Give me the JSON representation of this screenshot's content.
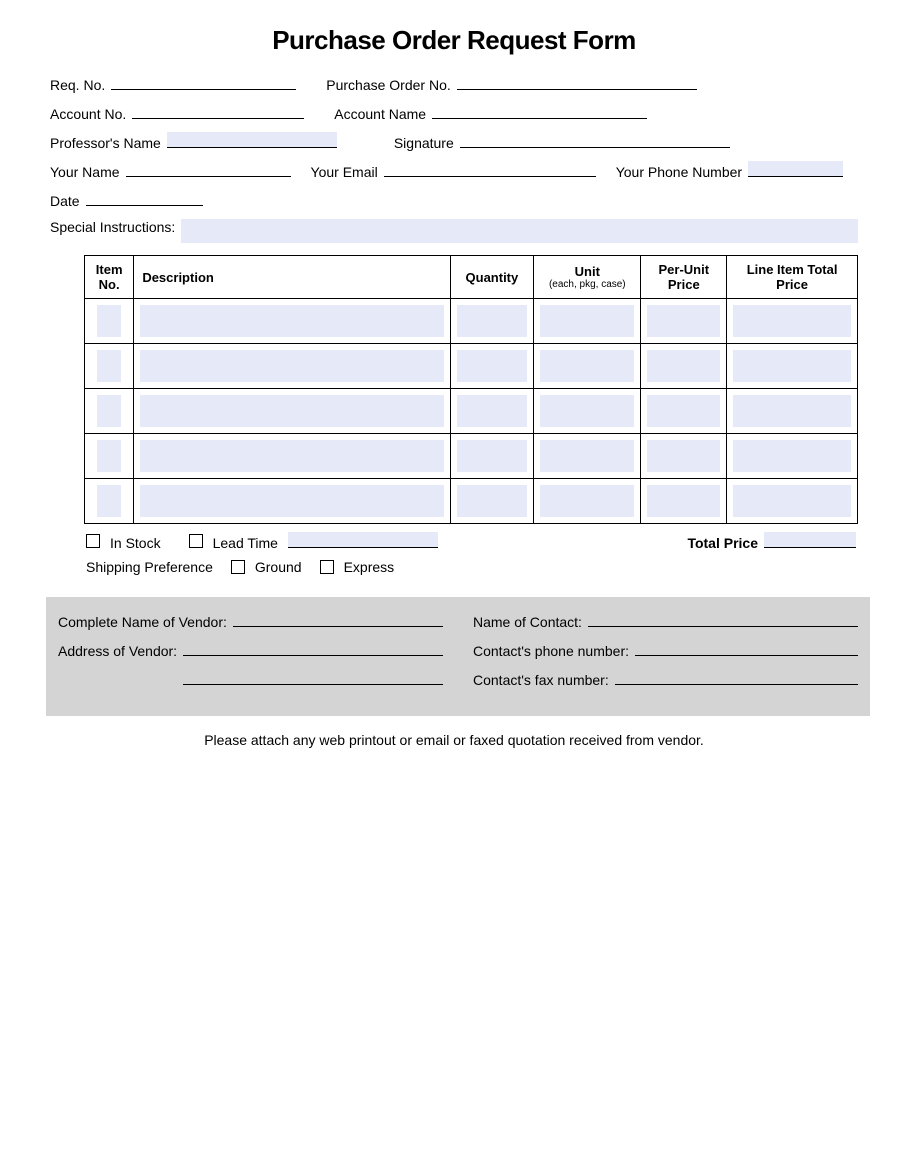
{
  "title": "Purchase Order Request Form",
  "fields": {
    "req_no": "Req. No.",
    "po_no": "Purchase Order No.",
    "account_no": "Account No.",
    "account_name": "Account Name",
    "professor_name": "Professor's Name",
    "signature": "Signature",
    "your_name": "Your Name",
    "your_email": "Your Email",
    "your_phone": "Your Phone Number",
    "date": "Date",
    "special_instructions": "Special Instructions:"
  },
  "table": {
    "headers": {
      "item_no": "Item No.",
      "description": "Description",
      "quantity": "Quantity",
      "unit": "Unit",
      "unit_sub": "(each, pkg, case)",
      "per_unit_price": "Per-Unit Price",
      "line_item_total": "Line Item Total Price"
    },
    "row_count": 5
  },
  "below": {
    "in_stock": "In Stock",
    "lead_time": "Lead Time",
    "total_price": "Total Price",
    "shipping_preference": "Shipping Preference",
    "ground": "Ground",
    "express": "Express"
  },
  "vendor": {
    "complete_name": "Complete Name of Vendor:",
    "address": "Address of Vendor:",
    "contact_name": "Name of Contact:",
    "contact_phone": "Contact's phone number:",
    "contact_fax": "Contact's fax number:"
  },
  "footnote": "Please attach any web printout or email or faxed quotation received from vendor."
}
